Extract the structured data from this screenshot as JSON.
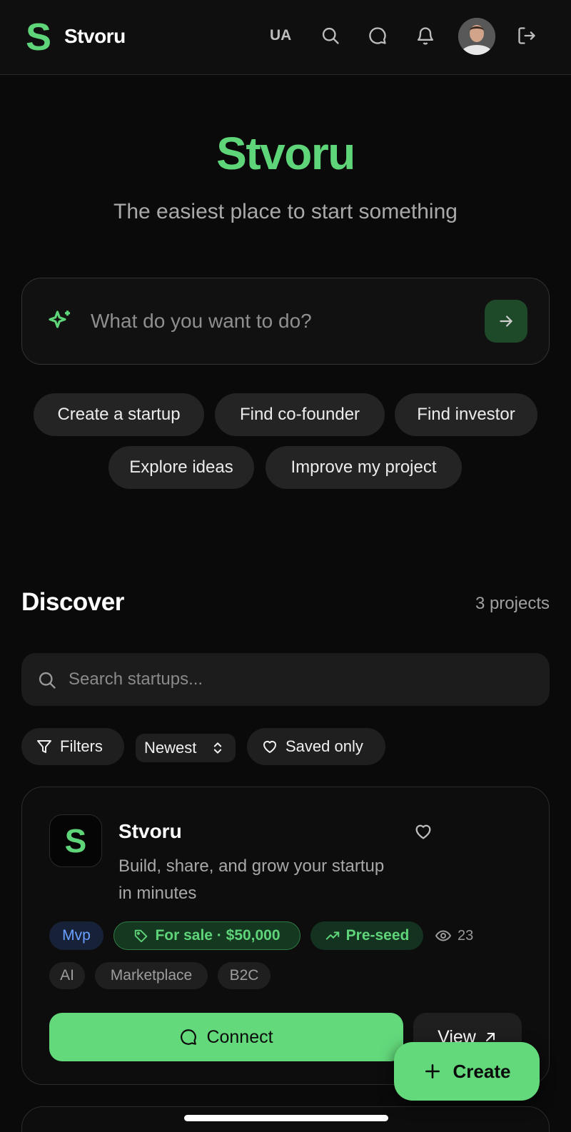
{
  "colors": {
    "accent": "#5fd57a",
    "button": "#64d97c",
    "background": "#0a0a0a"
  },
  "header": {
    "brand": "Stvoru",
    "logo_letter": "S",
    "language": "UA",
    "icons": [
      "search-icon",
      "message-icon",
      "bell-icon",
      "avatar",
      "logout-icon"
    ]
  },
  "hero": {
    "title": "Stvoru",
    "subtitle": "The easiest place to start something",
    "prompt_placeholder": "What do you want to do?"
  },
  "quick_actions": [
    "Create a startup",
    "Find co-founder",
    "Find investor",
    "Explore ideas",
    "Improve my project"
  ],
  "discover": {
    "title": "Discover",
    "count": "3 projects",
    "search_placeholder": "Search startups...",
    "filters_label": "Filters",
    "sort_value": "Newest",
    "saved_label": "Saved only"
  },
  "project": {
    "logo_letter": "S",
    "name": "Stvoru",
    "description": "Build, share, and grow your startup in minutes",
    "stage_badge": "Mvp",
    "sale_badge": "For sale · $50,000",
    "funding_badge": "Pre-seed",
    "views": "23",
    "tags": [
      "AI",
      "Marketplace",
      "B2C"
    ],
    "connect_label": "Connect",
    "view_label": "View"
  },
  "fab": {
    "label": "Create"
  }
}
